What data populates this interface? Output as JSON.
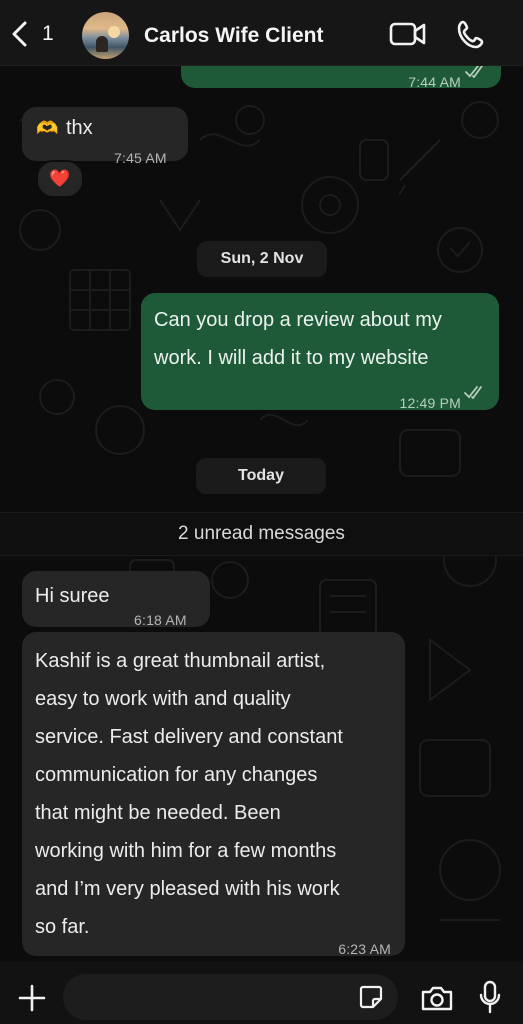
{
  "header": {
    "back_count": "1",
    "contact_name": "Carlos Wife Client",
    "icons": [
      "chevron-left-icon",
      "video-call-icon",
      "phone-icon"
    ]
  },
  "messages": [
    {
      "direction": "outgoing",
      "text": "",
      "time": "7:44 AM",
      "status": "read"
    },
    {
      "direction": "incoming",
      "emoji": "🫶",
      "text": "thx",
      "time": "7:45 AM",
      "reaction": "❤️"
    },
    {
      "type": "date",
      "text": "Sun, 2 Nov"
    },
    {
      "direction": "outgoing",
      "line1": "Can you drop a review about my",
      "line2": "work. I will add it to my website",
      "time": "12:49 PM",
      "status": "read"
    },
    {
      "type": "date",
      "text": "Today"
    },
    {
      "type": "unread",
      "text": "2 unread messages"
    },
    {
      "direction": "incoming",
      "text": "Hi suree",
      "time": "6:18 AM"
    },
    {
      "direction": "incoming",
      "lines": [
        "Kashif is a great thumbnail artist,",
        "easy to work with and quality",
        "service. Fast delivery and constant",
        "communication for any changes",
        "that might be needed. Been",
        "working with him for a few months",
        "and I’m very pleased with his work",
        "so far."
      ],
      "time": "6:23 AM"
    }
  ],
  "composer": {
    "placeholder": "",
    "icons": [
      "plus-icon",
      "sticker-icon",
      "camera-icon",
      "microphone-icon"
    ]
  },
  "colors": {
    "outgoing_bubble": "#1e5a38",
    "incoming_bubble": "#262626",
    "background": "#0c0c0c"
  }
}
